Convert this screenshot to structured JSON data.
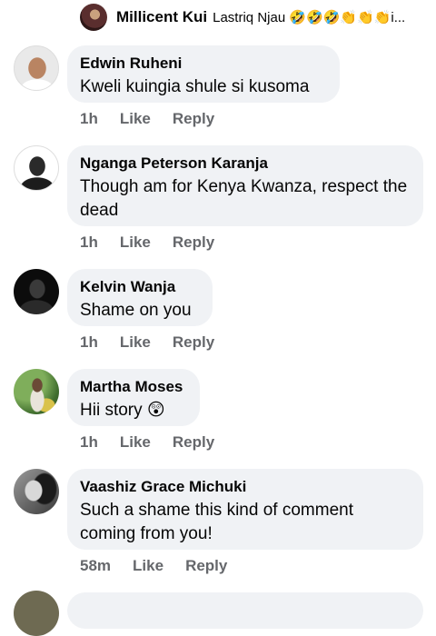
{
  "top_reply": {
    "author": "Millicent Kui",
    "text": "Lastriq Njau 🤣🤣🤣👏👏👏i..."
  },
  "comments": [
    {
      "author": "Edwin Ruheni",
      "text": "Kweli kuingia shule si kusoma",
      "time": "1h",
      "like_label": "Like",
      "reply_label": "Reply"
    },
    {
      "author": "Nganga Peterson Karanja",
      "text": "Though am for Kenya Kwanza, respect the dead",
      "time": "1h",
      "like_label": "Like",
      "reply_label": "Reply"
    },
    {
      "author": "Kelvin Wanja",
      "text": "Shame on you",
      "time": "1h",
      "like_label": "Like",
      "reply_label": "Reply"
    },
    {
      "author": "Martha Moses",
      "text": "Hii story 😲",
      "time": "1h",
      "like_label": "Like",
      "reply_label": "Reply"
    },
    {
      "author": "Vaashiz Grace Michuki",
      "text": "Such a shame this kind of comment coming from you!",
      "time": "58m",
      "like_label": "Like",
      "reply_label": "Reply"
    }
  ]
}
